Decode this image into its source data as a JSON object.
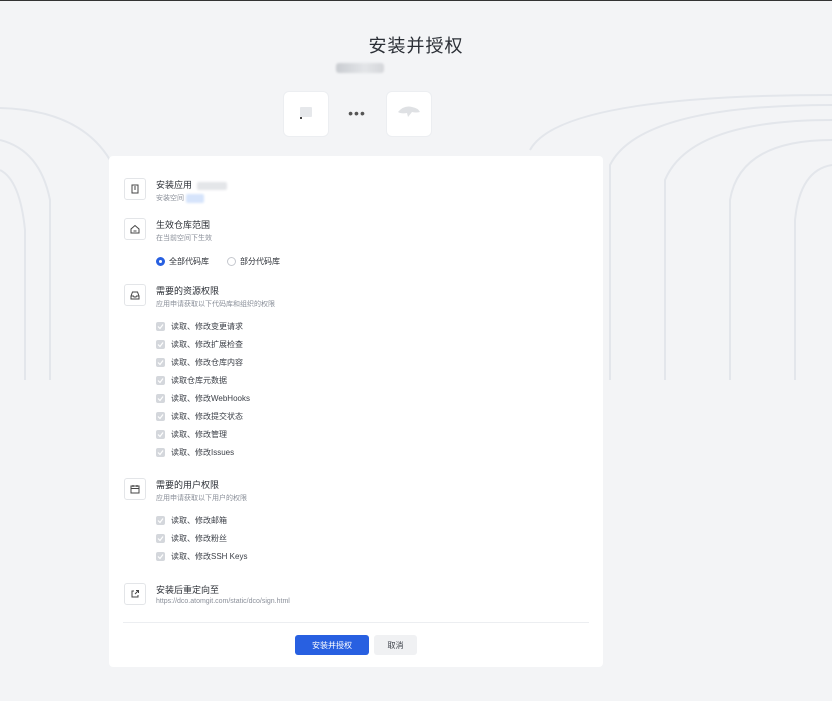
{
  "header": {
    "title": "安装并授权",
    "connector_dots": "•••"
  },
  "sections": {
    "install_app": {
      "title": "安装应用",
      "desc": "安装空间",
      "icon": "building-icon"
    },
    "repo_scope": {
      "title": "生效仓库范围",
      "desc": "在当前空间下生效",
      "icon": "home-icon",
      "options": [
        {
          "label": "全部代码库",
          "selected": true
        },
        {
          "label": "部分代码库",
          "selected": false
        }
      ]
    },
    "resource_perms": {
      "title": "需要的资源权限",
      "desc": "应用申请获取以下代码库和组织的权限",
      "icon": "inbox-icon",
      "items": [
        "读取、修改变更请求",
        "读取、修改扩展检查",
        "读取、修改仓库内容",
        "读取仓库元数据",
        "读取、修改WebHooks",
        "读取、修改提交状态",
        "读取、修改管理",
        "读取、修改Issues"
      ]
    },
    "user_perms": {
      "title": "需要的用户权限",
      "desc": "应用申请获取以下用户的权限",
      "icon": "calendar-icon",
      "items": [
        "读取、修改邮箱",
        "读取、修改粉丝",
        "读取、修改SSH Keys"
      ]
    },
    "redirect": {
      "title": "安装后重定向至",
      "url": "https://dco.atomgit.com/static/dco/sign.html",
      "icon": "external-link-icon"
    }
  },
  "actions": {
    "confirm": "安装并授权",
    "cancel": "取消"
  },
  "colors": {
    "primary": "#2860e1",
    "background": "#f3f4f6",
    "panel": "#ffffff",
    "checkbox_disabled": "#d4d7dc"
  }
}
